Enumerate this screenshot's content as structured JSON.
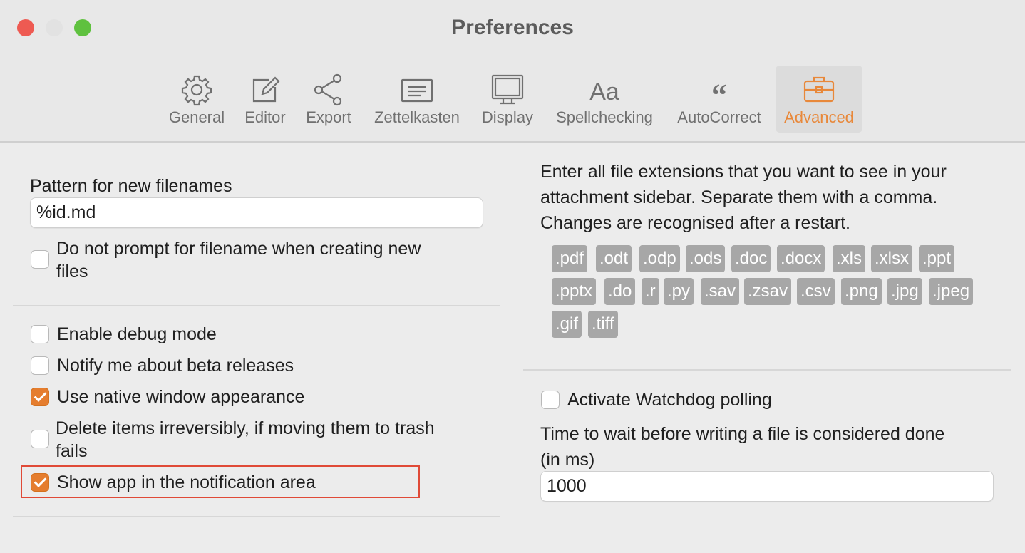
{
  "window": {
    "title": "Preferences"
  },
  "tabs": [
    {
      "label": "General",
      "icon": "gear-icon"
    },
    {
      "label": "Editor",
      "icon": "edit-icon"
    },
    {
      "label": "Export",
      "icon": "share-icon"
    },
    {
      "label": "Zettelkasten",
      "icon": "note-icon"
    },
    {
      "label": "Display",
      "icon": "display-icon"
    },
    {
      "label": "Spellchecking",
      "icon": "text-aa-icon"
    },
    {
      "label": "AutoCorrect",
      "icon": "quote-icon"
    },
    {
      "label": "Advanced",
      "icon": "toolbox-icon",
      "active": true
    }
  ],
  "left": {
    "filename_pattern": {
      "label": "Pattern for new filenames",
      "value": "%id.md"
    },
    "no_prompt": {
      "label_line1": "Do not prompt for filename when creating new",
      "label_line2": "files",
      "checked": false
    },
    "debug": {
      "label": "Enable debug mode",
      "checked": false
    },
    "beta": {
      "label": "Notify me about beta releases",
      "checked": false
    },
    "native": {
      "label": "Use native window appearance",
      "checked": true
    },
    "delete": {
      "label_line1": "Delete items irreversibly, if moving them to trash",
      "label_line2": "fails",
      "checked": false
    },
    "tray": {
      "label": "Show app in the notification area",
      "checked": true
    }
  },
  "right": {
    "ext_desc": {
      "line1": "Enter all file extensions that you want to see in your",
      "line2": "attachment sidebar. Separate them with a comma.",
      "line3": "Changes are recognised after a restart."
    },
    "extensions": [
      ".pdf",
      ".odt",
      ".odp",
      ".ods",
      ".doc",
      ".docx",
      ".xls",
      ".xlsx",
      ".ppt",
      ".pptx",
      ".do",
      ".r",
      ".py",
      ".sav",
      ".zsav",
      ".csv",
      ".png",
      ".jpg",
      ".jpeg",
      ".gif",
      ".tiff"
    ],
    "watchdog": {
      "label": "Activate Watchdog polling",
      "checked": false
    },
    "wait": {
      "label_line1": "Time to wait before writing a file is considered done",
      "label_line2": "(in ms)",
      "value": "1000"
    }
  },
  "colors": {
    "accent": "#e57d2e",
    "highlight": "#e04a37",
    "tag": "#a7a7a7"
  }
}
